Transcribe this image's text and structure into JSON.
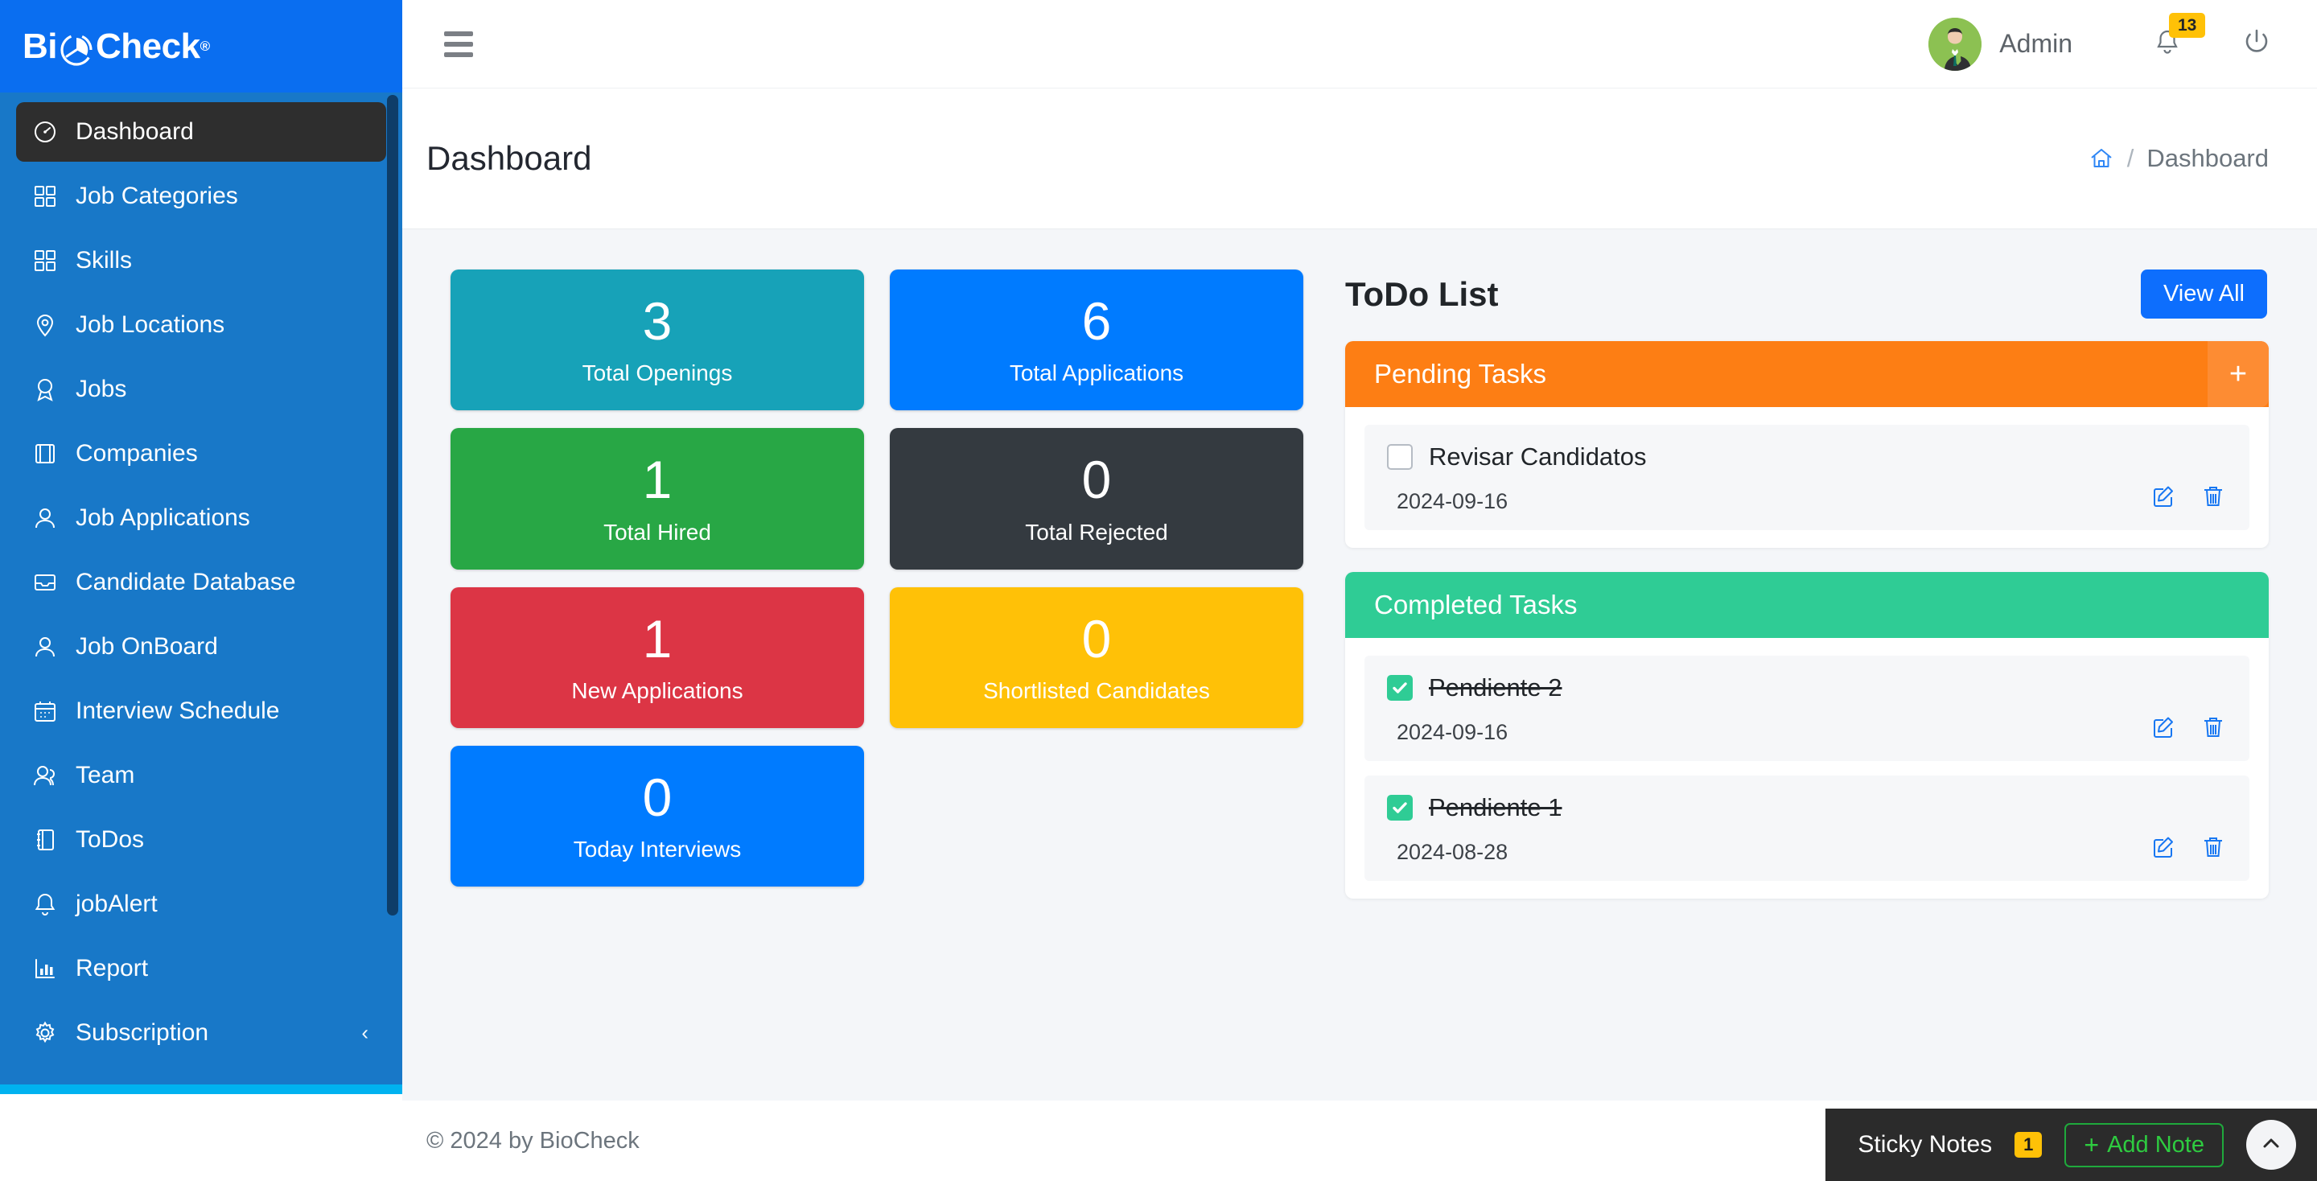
{
  "brand": {
    "name_part1": "Bi",
    "name_part2": "Check",
    "registered": "®",
    "logo_icon": "clock-pie-icon"
  },
  "sidebar": {
    "items": [
      {
        "label": "Dashboard",
        "icon": "speedometer-icon",
        "active": true
      },
      {
        "label": "Job Categories",
        "icon": "grid-squares-icon",
        "active": false
      },
      {
        "label": "Skills",
        "icon": "grid-squares-icon",
        "active": false
      },
      {
        "label": "Job Locations",
        "icon": "map-pin-icon",
        "active": false
      },
      {
        "label": "Jobs",
        "icon": "award-badge-icon",
        "active": false
      },
      {
        "label": "Companies",
        "icon": "film-strip-icon",
        "active": false
      },
      {
        "label": "Job Applications",
        "icon": "person-icon",
        "active": false
      },
      {
        "label": "Candidate Database",
        "icon": "inbox-tray-icon",
        "active": false
      },
      {
        "label": "Job OnBoard",
        "icon": "person-icon",
        "active": false
      },
      {
        "label": "Interview Schedule",
        "icon": "calendar-icon",
        "active": false
      },
      {
        "label": "Team",
        "icon": "people-group-icon",
        "active": false
      },
      {
        "label": "ToDos",
        "icon": "notebook-icon",
        "active": false
      },
      {
        "label": "jobAlert",
        "icon": "bell-icon",
        "active": false
      },
      {
        "label": "Report",
        "icon": "bar-chart-icon",
        "active": false
      },
      {
        "label": "Subscription",
        "icon": "gear-icon",
        "active": false,
        "caret": "‹"
      }
    ]
  },
  "topbar": {
    "menu_toggle_icon": "hamburger-icon",
    "avatar_icon": "user-avatar-icon",
    "user_name": "Admin",
    "notification_icon": "bell-icon",
    "notification_count": "13",
    "logout_icon": "power-icon"
  },
  "page": {
    "title": "Dashboard",
    "breadcrumb": {
      "home_icon": "home-icon",
      "separator": "/",
      "current": "Dashboard"
    }
  },
  "stats": {
    "left_column": [
      {
        "value": "3",
        "label": "Total Openings",
        "color": "#17a2b8"
      },
      {
        "value": "1",
        "label": "Total Hired",
        "color": "#28a745"
      },
      {
        "value": "1",
        "label": "New Applications",
        "color": "#dc3545"
      },
      {
        "value": "0",
        "label": "Today Interviews",
        "color": "#007bff"
      }
    ],
    "right_column": [
      {
        "value": "6",
        "label": "Total Applications",
        "color": "#007bff"
      },
      {
        "value": "0",
        "label": "Total Rejected",
        "color": "#343a40"
      },
      {
        "value": "0",
        "label": "Shortlisted Candidates",
        "color": "#ffc107"
      }
    ]
  },
  "todo": {
    "title": "ToDo List",
    "view_all_label": "View All",
    "pending": {
      "header": "Pending Tasks",
      "add_label": "+",
      "tasks": [
        {
          "name": "Revisar Candidatos",
          "date": "2024-09-16",
          "checked": false,
          "edit_icon": "pencil-square-icon",
          "delete_icon": "trash-icon"
        }
      ]
    },
    "completed": {
      "header": "Completed Tasks",
      "tasks": [
        {
          "name": "Pendiente 2",
          "date": "2024-09-16",
          "checked": true,
          "edit_icon": "pencil-square-icon",
          "delete_icon": "trash-icon"
        },
        {
          "name": "Pendiente 1",
          "date": "2024-08-28",
          "checked": true,
          "edit_icon": "pencil-square-icon",
          "delete_icon": "trash-icon"
        }
      ]
    }
  },
  "footer": {
    "text": "© 2024 by BioCheck"
  },
  "sticky": {
    "label": "Sticky Notes",
    "count": "1",
    "add_label": "Add Note",
    "add_plus": "+",
    "collapse_icon": "chevron-up-icon"
  },
  "colors": {
    "brand_blue": "#0a6ef0",
    "sidebar_blue": "#1878c8",
    "accent_cyan": "#00b2f0",
    "pending_orange": "#fd7e14",
    "completed_green": "#2fcc95",
    "badge_yellow": "#ffc107",
    "content_bg": "#f4f6f9"
  }
}
